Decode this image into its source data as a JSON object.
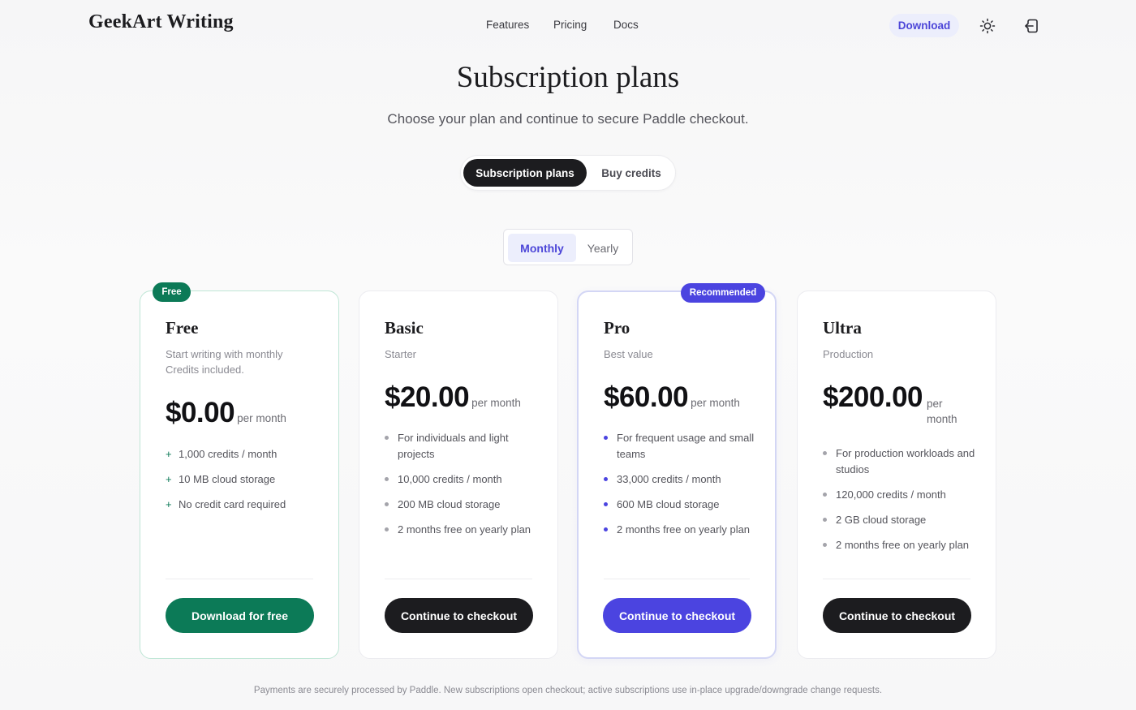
{
  "header": {
    "brand": "GeekArt Writing",
    "nav": [
      "Features",
      "Pricing",
      "Docs"
    ],
    "download_label": "Download",
    "theme_icon": "sun-icon",
    "logout_icon": "sign-out-icon"
  },
  "hero": {
    "title": "Subscription plans",
    "subtitle": "Choose your plan and continue to secure Paddle checkout."
  },
  "mode_toggle": {
    "options": [
      "Subscription plans",
      "Buy credits"
    ],
    "selected": "Subscription plans"
  },
  "period_toggle": {
    "options": [
      "Monthly",
      "Yearly"
    ],
    "selected": "Monthly"
  },
  "plans": [
    {
      "badge": "Free",
      "name": "Free",
      "desc": "Start writing with monthly Credits included.",
      "price": "$0.00",
      "per": "per month",
      "features": [
        "1,000 credits / month",
        "10 MB cloud storage",
        "No credit card required"
      ],
      "cta": "Download for free"
    },
    {
      "name": "Basic",
      "desc": "Starter",
      "price": "$20.00",
      "per": "per month",
      "features": [
        "For individuals and light projects",
        "10,000 credits / month",
        "200 MB cloud storage",
        "2 months free on yearly plan"
      ],
      "cta": "Continue to checkout"
    },
    {
      "badge": "Recommended",
      "name": "Pro",
      "desc": "Best value",
      "price": "$60.00",
      "per": "per month",
      "features": [
        "For frequent usage and small teams",
        "33,000 credits / month",
        "600 MB cloud storage",
        "2 months free on yearly plan"
      ],
      "cta": "Continue to checkout"
    },
    {
      "name": "Ultra",
      "desc": "Production",
      "price": "$200.00",
      "per": "per month",
      "features": [
        "For production workloads and studios",
        "120,000 credits / month",
        "2 GB cloud storage",
        "2 months free on yearly plan"
      ],
      "cta": "Continue to checkout"
    }
  ],
  "colors": {
    "accent": "#4b44e0",
    "green": "#0c7a57",
    "dark": "#1c1c1f",
    "accent_soft": "#eceefc"
  },
  "footnote": "Payments are securely processed by Paddle. New subscriptions open checkout; active subscriptions use in-place upgrade/downgrade change requests."
}
